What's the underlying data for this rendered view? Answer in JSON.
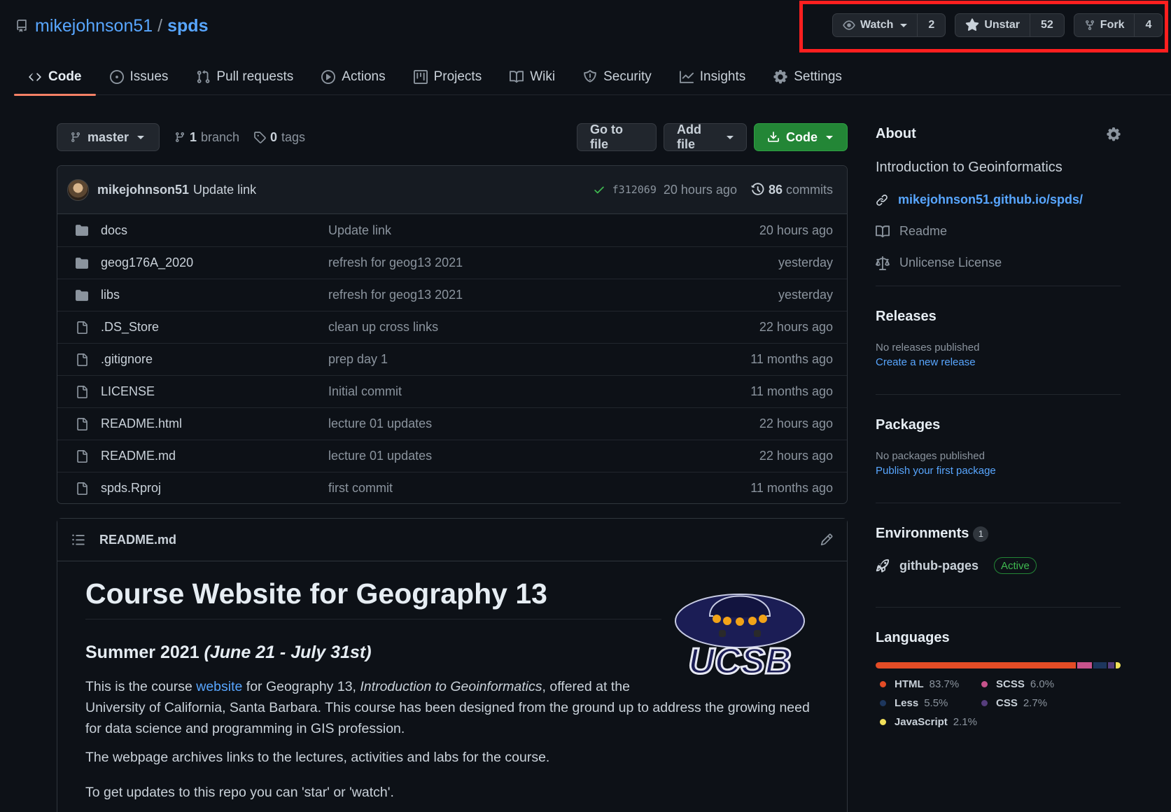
{
  "repo": {
    "owner": "mikejohnson51",
    "separator": "/",
    "name": "spds"
  },
  "social": {
    "watch_label": "Watch",
    "watch_count": "2",
    "star_label": "Unstar",
    "star_count": "52",
    "fork_label": "Fork",
    "fork_count": "4"
  },
  "tabs": [
    {
      "label": "Code",
      "icon": "code-icon"
    },
    {
      "label": "Issues",
      "icon": "issue-icon"
    },
    {
      "label": "Pull requests",
      "icon": "pull-request-icon"
    },
    {
      "label": "Actions",
      "icon": "play-icon"
    },
    {
      "label": "Projects",
      "icon": "project-icon"
    },
    {
      "label": "Wiki",
      "icon": "book-icon"
    },
    {
      "label": "Security",
      "icon": "shield-icon"
    },
    {
      "label": "Insights",
      "icon": "graph-icon"
    },
    {
      "label": "Settings",
      "icon": "gear-icon"
    }
  ],
  "file_nav": {
    "branch": "master",
    "branch_count": "1",
    "branch_label": "branch",
    "tag_count": "0",
    "tag_label": "tags",
    "goto_file": "Go to file",
    "add_file": "Add file",
    "code": "Code"
  },
  "latest_commit": {
    "author": "mikejohnson51",
    "message": "Update link",
    "sha": "f312069",
    "time": "20 hours ago",
    "commit_count": "86",
    "commit_label": "commits"
  },
  "files": [
    {
      "type": "dir",
      "name": "docs",
      "message": "Update link",
      "age": "20 hours ago"
    },
    {
      "type": "dir",
      "name": "geog176A_2020",
      "message": "refresh for geog13 2021",
      "age": "yesterday"
    },
    {
      "type": "dir",
      "name": "libs",
      "message": "refresh for geog13 2021",
      "age": "yesterday"
    },
    {
      "type": "file",
      "name": ".DS_Store",
      "message": "clean up cross links",
      "age": "22 hours ago"
    },
    {
      "type": "file",
      "name": ".gitignore",
      "message": "prep day 1",
      "age": "11 months ago"
    },
    {
      "type": "file",
      "name": "LICENSE",
      "message": "Initial commit",
      "age": "11 months ago"
    },
    {
      "type": "file",
      "name": "README.html",
      "message": "lecture 01 updates",
      "age": "22 hours ago"
    },
    {
      "type": "file",
      "name": "README.md",
      "message": "lecture 01 updates",
      "age": "22 hours ago"
    },
    {
      "type": "file",
      "name": "spds.Rproj",
      "message": "first commit",
      "age": "11 months ago"
    }
  ],
  "readme": {
    "filename": "README.md",
    "title": "Course Website for Geography 13",
    "subtitle_plain": "Summer 2021 ",
    "subtitle_italic": "(June 21 - July 31st)",
    "p1_a": "This is the course ",
    "p1_link": "website",
    "p1_b": " for Geography 13, ",
    "p1_italic": "Introduction to Geoinformatics",
    "p1_c": ", offered at the",
    "p1_line2": "University of California, Santa Barbara. This course has been designed from the ground up to address the growing need",
    "p1_line3": "for data science and programming in GIS profession.",
    "p2": "The webpage archives links to the lectures, activities and labs for the course.",
    "p3": "To get updates to this repo you can 'star' or 'watch'.",
    "logo_text": "UCSB"
  },
  "about": {
    "heading": "About",
    "description": "Introduction to Geoinformatics",
    "website": "mikejohnson51.github.io/spds/",
    "readme": "Readme",
    "license": "Unlicense License"
  },
  "releases": {
    "heading": "Releases",
    "none": "No releases published",
    "create": "Create a new release"
  },
  "packages": {
    "heading": "Packages",
    "none": "No packages published",
    "publish": "Publish your first package"
  },
  "environments": {
    "heading": "Environments",
    "count": "1",
    "name": "github-pages",
    "status": "Active"
  },
  "languages": {
    "heading": "Languages",
    "items": [
      {
        "name": "HTML",
        "percent": "83.7%",
        "value": 83.7,
        "color": "#e34c26"
      },
      {
        "name": "SCSS",
        "percent": "6.0%",
        "value": 6.0,
        "color": "#c6538c"
      },
      {
        "name": "Less",
        "percent": "5.5%",
        "value": 5.5,
        "color": "#1d365d"
      },
      {
        "name": "CSS",
        "percent": "2.7%",
        "value": 2.7,
        "color": "#563d7c"
      },
      {
        "name": "JavaScript",
        "percent": "2.1%",
        "value": 2.1,
        "color": "#f1e05a"
      }
    ]
  },
  "colors": {
    "accent": "#58a6ff",
    "highlight_box": "#ff1f1f",
    "tab_underline": "#f78166",
    "primary_button": "#238636",
    "success": "#3fb950"
  }
}
